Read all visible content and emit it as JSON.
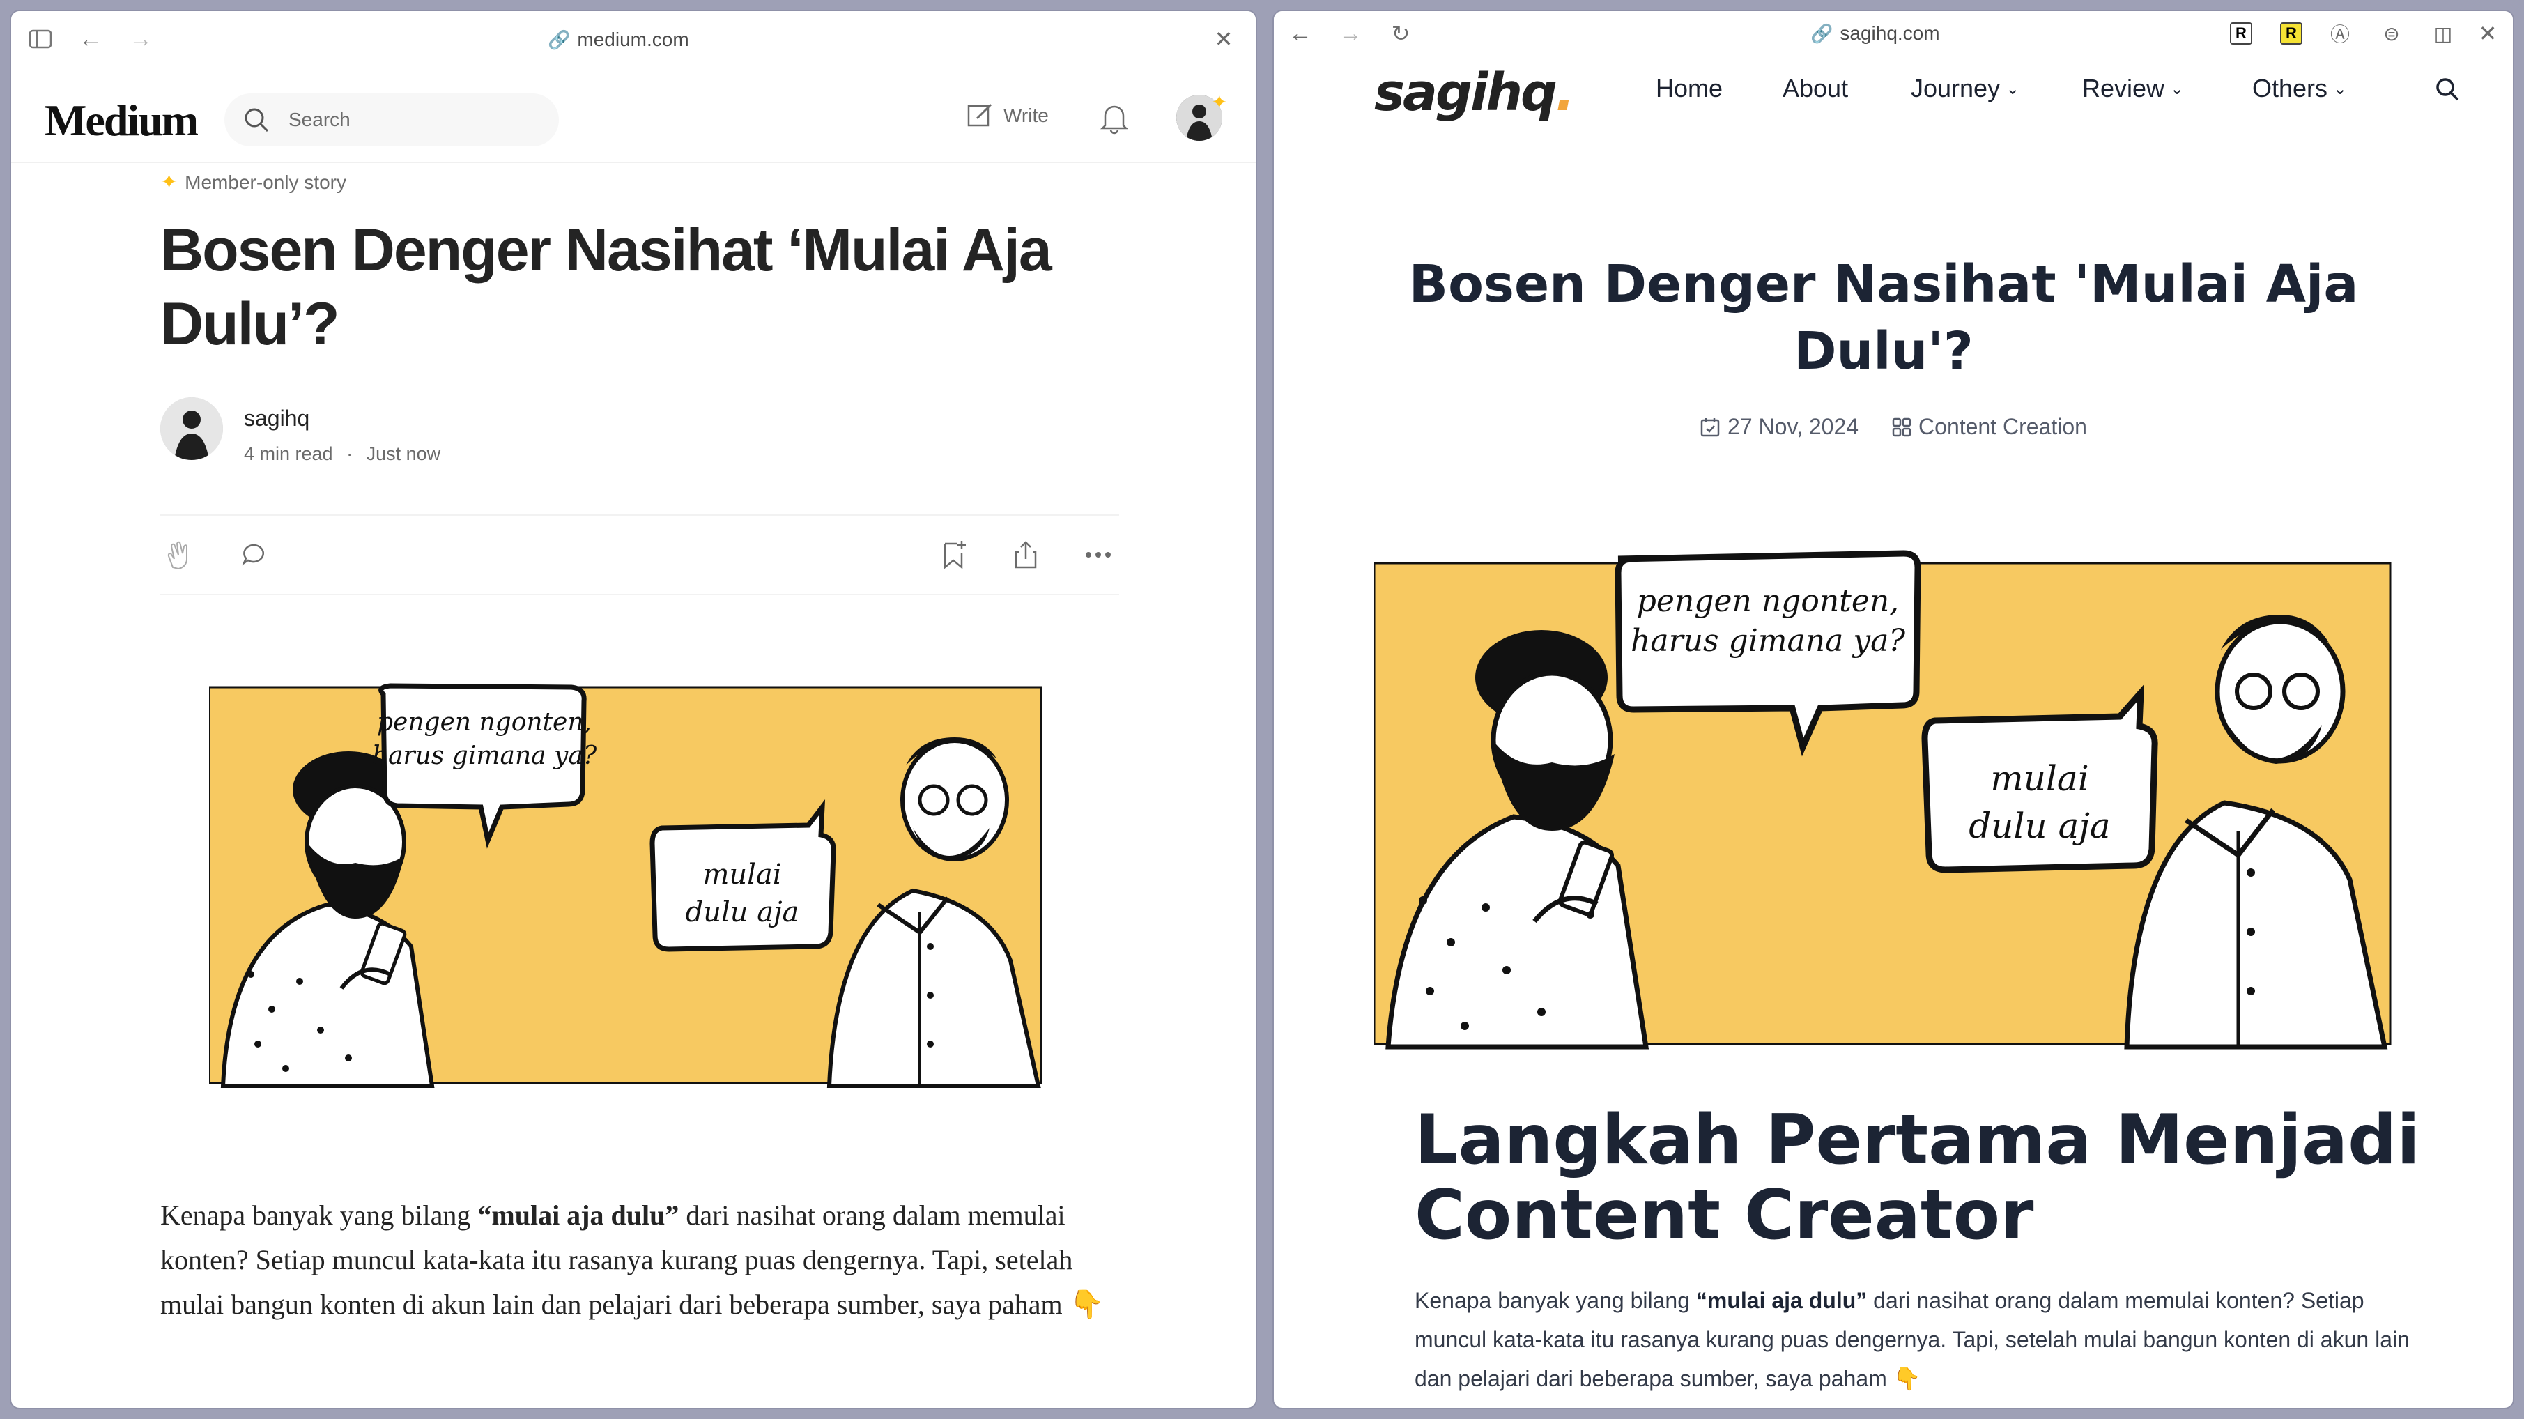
{
  "left_window": {
    "url": "medium.com",
    "header": {
      "logo": "Medium",
      "search_placeholder": "Search",
      "write_label": "Write"
    },
    "article": {
      "member_label": "Member-only story",
      "title": "Bosen Denger Nasihat ‘Mulai Aja Dulu’?",
      "author": "sagihq",
      "read_time": "4 min read",
      "separator": "·",
      "published": "Just now",
      "illustration": {
        "bubble_1": [
          "pengen ngonten,",
          "harus gimana ya?"
        ],
        "bubble_2": [
          "mulai",
          "dulu aja"
        ]
      },
      "body_before": "Kenapa banyak yang bilang ",
      "body_bold": "“mulai aja dulu”",
      "body_after": " dari nasihat orang dalam memulai konten? Setiap muncul kata-kata itu rasanya kurang puas dengernya. Tapi, setelah mulai bangun konten di akun lain dan pelajari dari beberapa sumber, saya paham 👇"
    }
  },
  "right_window": {
    "url": "sagihq.com",
    "extensions": [
      "R",
      "R"
    ],
    "nav": {
      "logo": "sagihq",
      "logo_dot": ".",
      "links": [
        "Home",
        "About",
        "Journey",
        "Review",
        "Others"
      ]
    },
    "article": {
      "title": "Bosen Denger Nasihat 'Mulai Aja Dulu'?",
      "date": "27 Nov, 2024",
      "category": "Content Creation",
      "illustration": {
        "bubble_1": [
          "pengen ngonten,",
          "harus gimana ya?"
        ],
        "bubble_2": [
          "mulai",
          "dulu aja"
        ]
      },
      "heading": "Langkah Pertama Menjadi Content Creator",
      "body_before": "Kenapa banyak yang bilang ",
      "body_bold": "“mulai aja dulu”",
      "body_after": " dari nasihat orang dalam memulai konten? Setiap muncul kata-kata itu rasanya kurang puas dengernya. Tapi, setelah mulai bangun konten di akun lain dan pelajari dari beberapa sumber, saya paham 👇"
    }
  },
  "colors": {
    "illustration_bg": "#f7c961",
    "medium_text": "#242424",
    "sagihq_text": "#1c2434",
    "accent_star": "#ffc017"
  }
}
